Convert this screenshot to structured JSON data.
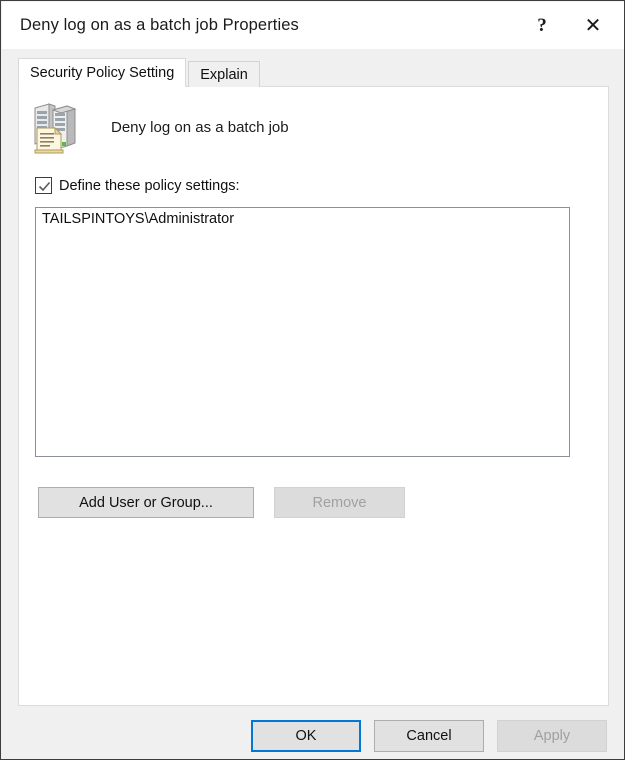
{
  "window": {
    "title": "Deny log on as a batch job Properties",
    "help_button": "?",
    "close_button": "✕"
  },
  "tabs": [
    {
      "label": "Security Policy Setting",
      "active": true
    },
    {
      "label": "Explain",
      "active": false
    }
  ],
  "policy": {
    "icon": "server-policy-icon",
    "name": "Deny log on as a batch job"
  },
  "define_checkbox": {
    "label": "Define these policy settings:",
    "checked": true,
    "icon": "checkmark-icon"
  },
  "principals_list": {
    "items": [
      "TAILSPINTOYS\\Administrator"
    ]
  },
  "list_buttons": {
    "add": "Add User or Group...",
    "remove": "Remove",
    "remove_disabled": true
  },
  "footer_buttons": {
    "ok": "OK",
    "cancel": "Cancel",
    "apply": "Apply",
    "apply_disabled": true
  },
  "colors": {
    "accent": "#0078d7",
    "dialog_bg": "#f0f0f0",
    "panel_bg": "#ffffff",
    "button_bg": "#e1e1e1",
    "disabled_text": "#a0a0a0",
    "text": "#101010"
  }
}
